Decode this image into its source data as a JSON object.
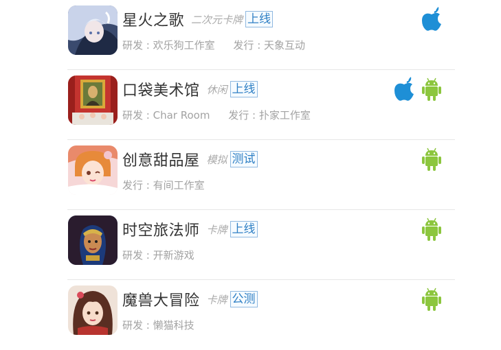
{
  "games": [
    {
      "name": "星火之歌",
      "genre": "二次元卡牌",
      "status": "上线",
      "meta": [
        {
          "label": "研发",
          "value": "欢乐狗工作室"
        },
        {
          "label": "发行",
          "value": "天象互动"
        }
      ],
      "platforms": [
        "apple-icon"
      ]
    },
    {
      "name": "口袋美术馆",
      "genre": "休闲",
      "status": "上线",
      "meta": [
        {
          "label": "研发",
          "value": "Char Room"
        },
        {
          "label": "发行",
          "value": "扑家工作室"
        }
      ],
      "platforms": [
        "apple-icon",
        "android-icon"
      ]
    },
    {
      "name": "创意甜品屋",
      "genre": "模拟",
      "status": "测试",
      "meta": [
        {
          "label": "发行",
          "value": "有间工作室"
        }
      ],
      "platforms": [
        "android-icon"
      ]
    },
    {
      "name": "时空旅法师",
      "genre": "卡牌",
      "status": "上线",
      "meta": [
        {
          "label": "研发",
          "value": "开新游戏"
        }
      ],
      "platforms": [
        "android-icon"
      ]
    },
    {
      "name": "魔兽大冒险",
      "genre": "卡牌",
      "status": "公测",
      "meta": [
        {
          "label": "研发",
          "value": "懒猫科技"
        }
      ],
      "platforms": [
        "android-icon"
      ]
    }
  ],
  "colors": {
    "apple": "#1e8fd6",
    "android": "#8cc63e",
    "status_text": "#2e7fc4",
    "divider": "#e6e6e6"
  }
}
